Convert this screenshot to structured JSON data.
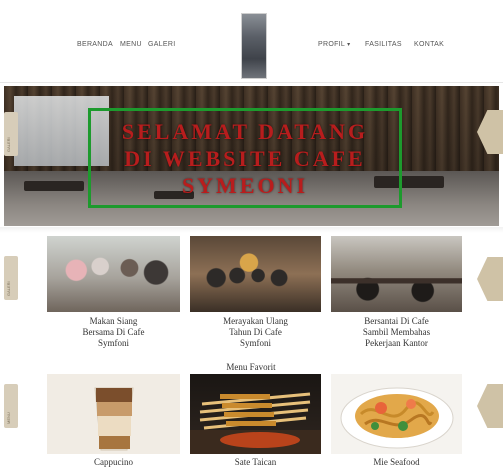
{
  "nav": {
    "left": [
      "BERANDA",
      "MENU",
      "GALERI"
    ],
    "right": [
      "PROFIL",
      "FASILITAS",
      "KONTAK"
    ],
    "profil_caret": "▾"
  },
  "hero": {
    "lines": [
      "SELAMAT DATANG",
      "DI WEBSITE CAFE",
      "SYMEONI"
    ]
  },
  "side_tabs": [
    "GALERI",
    "GALERI",
    "MENU"
  ],
  "gallery": [
    {
      "caption_lines": [
        "Makan Siang",
        "Bersama Di Cafe",
        "Symfoni"
      ]
    },
    {
      "caption_lines": [
        "Merayakan Ulang",
        "Tahun Di Cafe",
        "Symfoni"
      ]
    },
    {
      "caption_lines": [
        "Bersantai Di Cafe",
        "Sambil Membahas",
        "Pekerjaan Kantor"
      ]
    }
  ],
  "menu_section_title": "Menu Favorit",
  "menu": [
    {
      "caption": "Cappucino"
    },
    {
      "caption": "Sate Taican"
    },
    {
      "caption": "Mie Seafood"
    }
  ],
  "colors": {
    "hero_text": "#b81d1d",
    "hero_box": "#1d9a2d",
    "tab": "#d7cdb9",
    "hex": "#cfc2a6"
  }
}
